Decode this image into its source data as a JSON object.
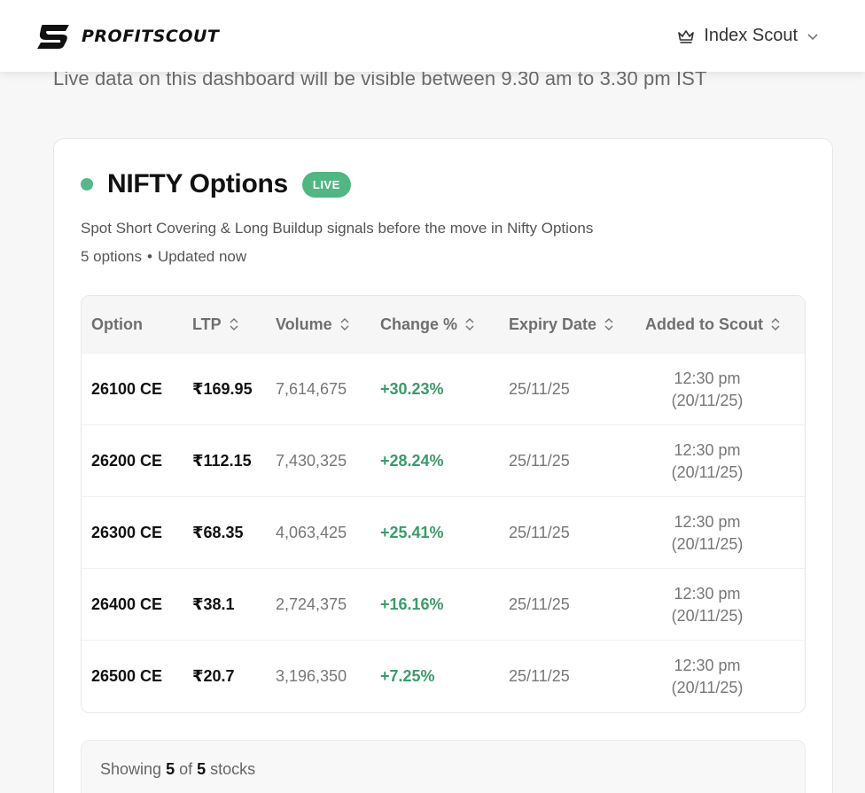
{
  "header": {
    "brand_name": "PROFITSCOUT",
    "index_menu_label": "Index Scout"
  },
  "notice": "Live data on this dashboard will be visible between 9.30 am to 3.30 pm IST",
  "card": {
    "title": "NIFTY Options",
    "badge": "LIVE",
    "subtitle": "Spot Short Covering & Long Buildup signals before the move in Nifty Options",
    "meta_count": "5 options",
    "meta_separator": "•",
    "meta_updated": "Updated now"
  },
  "table": {
    "columns": [
      "Option",
      "LTP",
      "Volume",
      "Change %",
      "Expiry Date",
      "Added to Scout"
    ],
    "rows": [
      {
        "option": "26100 CE",
        "ltp": "₹169.95",
        "volume": "7,614,675",
        "change": "+30.23%",
        "expiry": "25/11/25",
        "added_time": "12:30 pm",
        "added_date": "(20/11/25)"
      },
      {
        "option": "26200 CE",
        "ltp": "₹112.15",
        "volume": "7,430,325",
        "change": "+28.24%",
        "expiry": "25/11/25",
        "added_time": "12:30 pm",
        "added_date": "(20/11/25)"
      },
      {
        "option": "26300 CE",
        "ltp": "₹68.35",
        "volume": "4,063,425",
        "change": "+25.41%",
        "expiry": "25/11/25",
        "added_time": "12:30 pm",
        "added_date": "(20/11/25)"
      },
      {
        "option": "26400 CE",
        "ltp": "₹38.1",
        "volume": "2,724,375",
        "change": "+16.16%",
        "expiry": "25/11/25",
        "added_time": "12:30 pm",
        "added_date": "(20/11/25)"
      },
      {
        "option": "26500 CE",
        "ltp": "₹20.7",
        "volume": "3,196,350",
        "change": "+7.25%",
        "expiry": "25/11/25",
        "added_time": "12:30 pm",
        "added_date": "(20/11/25)"
      }
    ]
  },
  "footer": {
    "prefix": "Showing",
    "shown": "5",
    "of": "of",
    "total": "5",
    "suffix": "stocks"
  },
  "colors": {
    "live_green": "#52b683",
    "change_green": "#3d9a6a"
  },
  "icons": [
    "brand-logo-icon",
    "crown-icon",
    "chevron-down-icon",
    "sort-icon"
  ]
}
